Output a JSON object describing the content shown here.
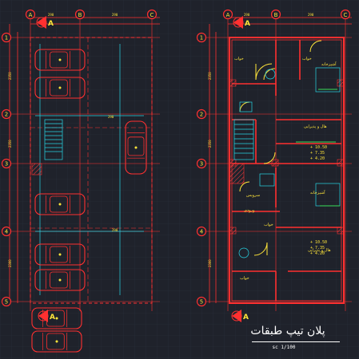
{
  "drawing": {
    "caption": "پلان تیپ طبقات",
    "scale": "1/100",
    "colors": {
      "background": "#1f222b",
      "grid": "#2b3140",
      "wall": "#ff2a2a",
      "wall_hatch": "#ff5050",
      "cyan": "#27d6e6",
      "green": "#38e05a",
      "yellow": "#ffe53a",
      "white": "#ffffff",
      "axis_bubble": "#ff3030"
    },
    "axes": {
      "top": [
        "A",
        "B",
        "C"
      ],
      "side": [
        "1",
        "2",
        "3",
        "4",
        "5"
      ]
    },
    "section_marks": [
      "A",
      "A",
      "A",
      "A"
    ],
    "room_labels": {
      "bedroom_1": "خواب",
      "bedroom_2": "خواب",
      "kitchen_1": "آشپزخانه",
      "kitchen_2": "آشپزخانه",
      "living_1": "هال و پذیرایی",
      "living_2": "هال و پذیرایی",
      "bedroom_3": "خواب",
      "bedroom_4": "خواب",
      "wc": "سرویس",
      "lobby": "ورودی"
    },
    "levels": {
      "upper": [
        "+10.50",
        "+7.35",
        "+4.20"
      ],
      "lower": [
        "+10.50",
        "+7.35",
        "+4.20"
      ]
    }
  }
}
